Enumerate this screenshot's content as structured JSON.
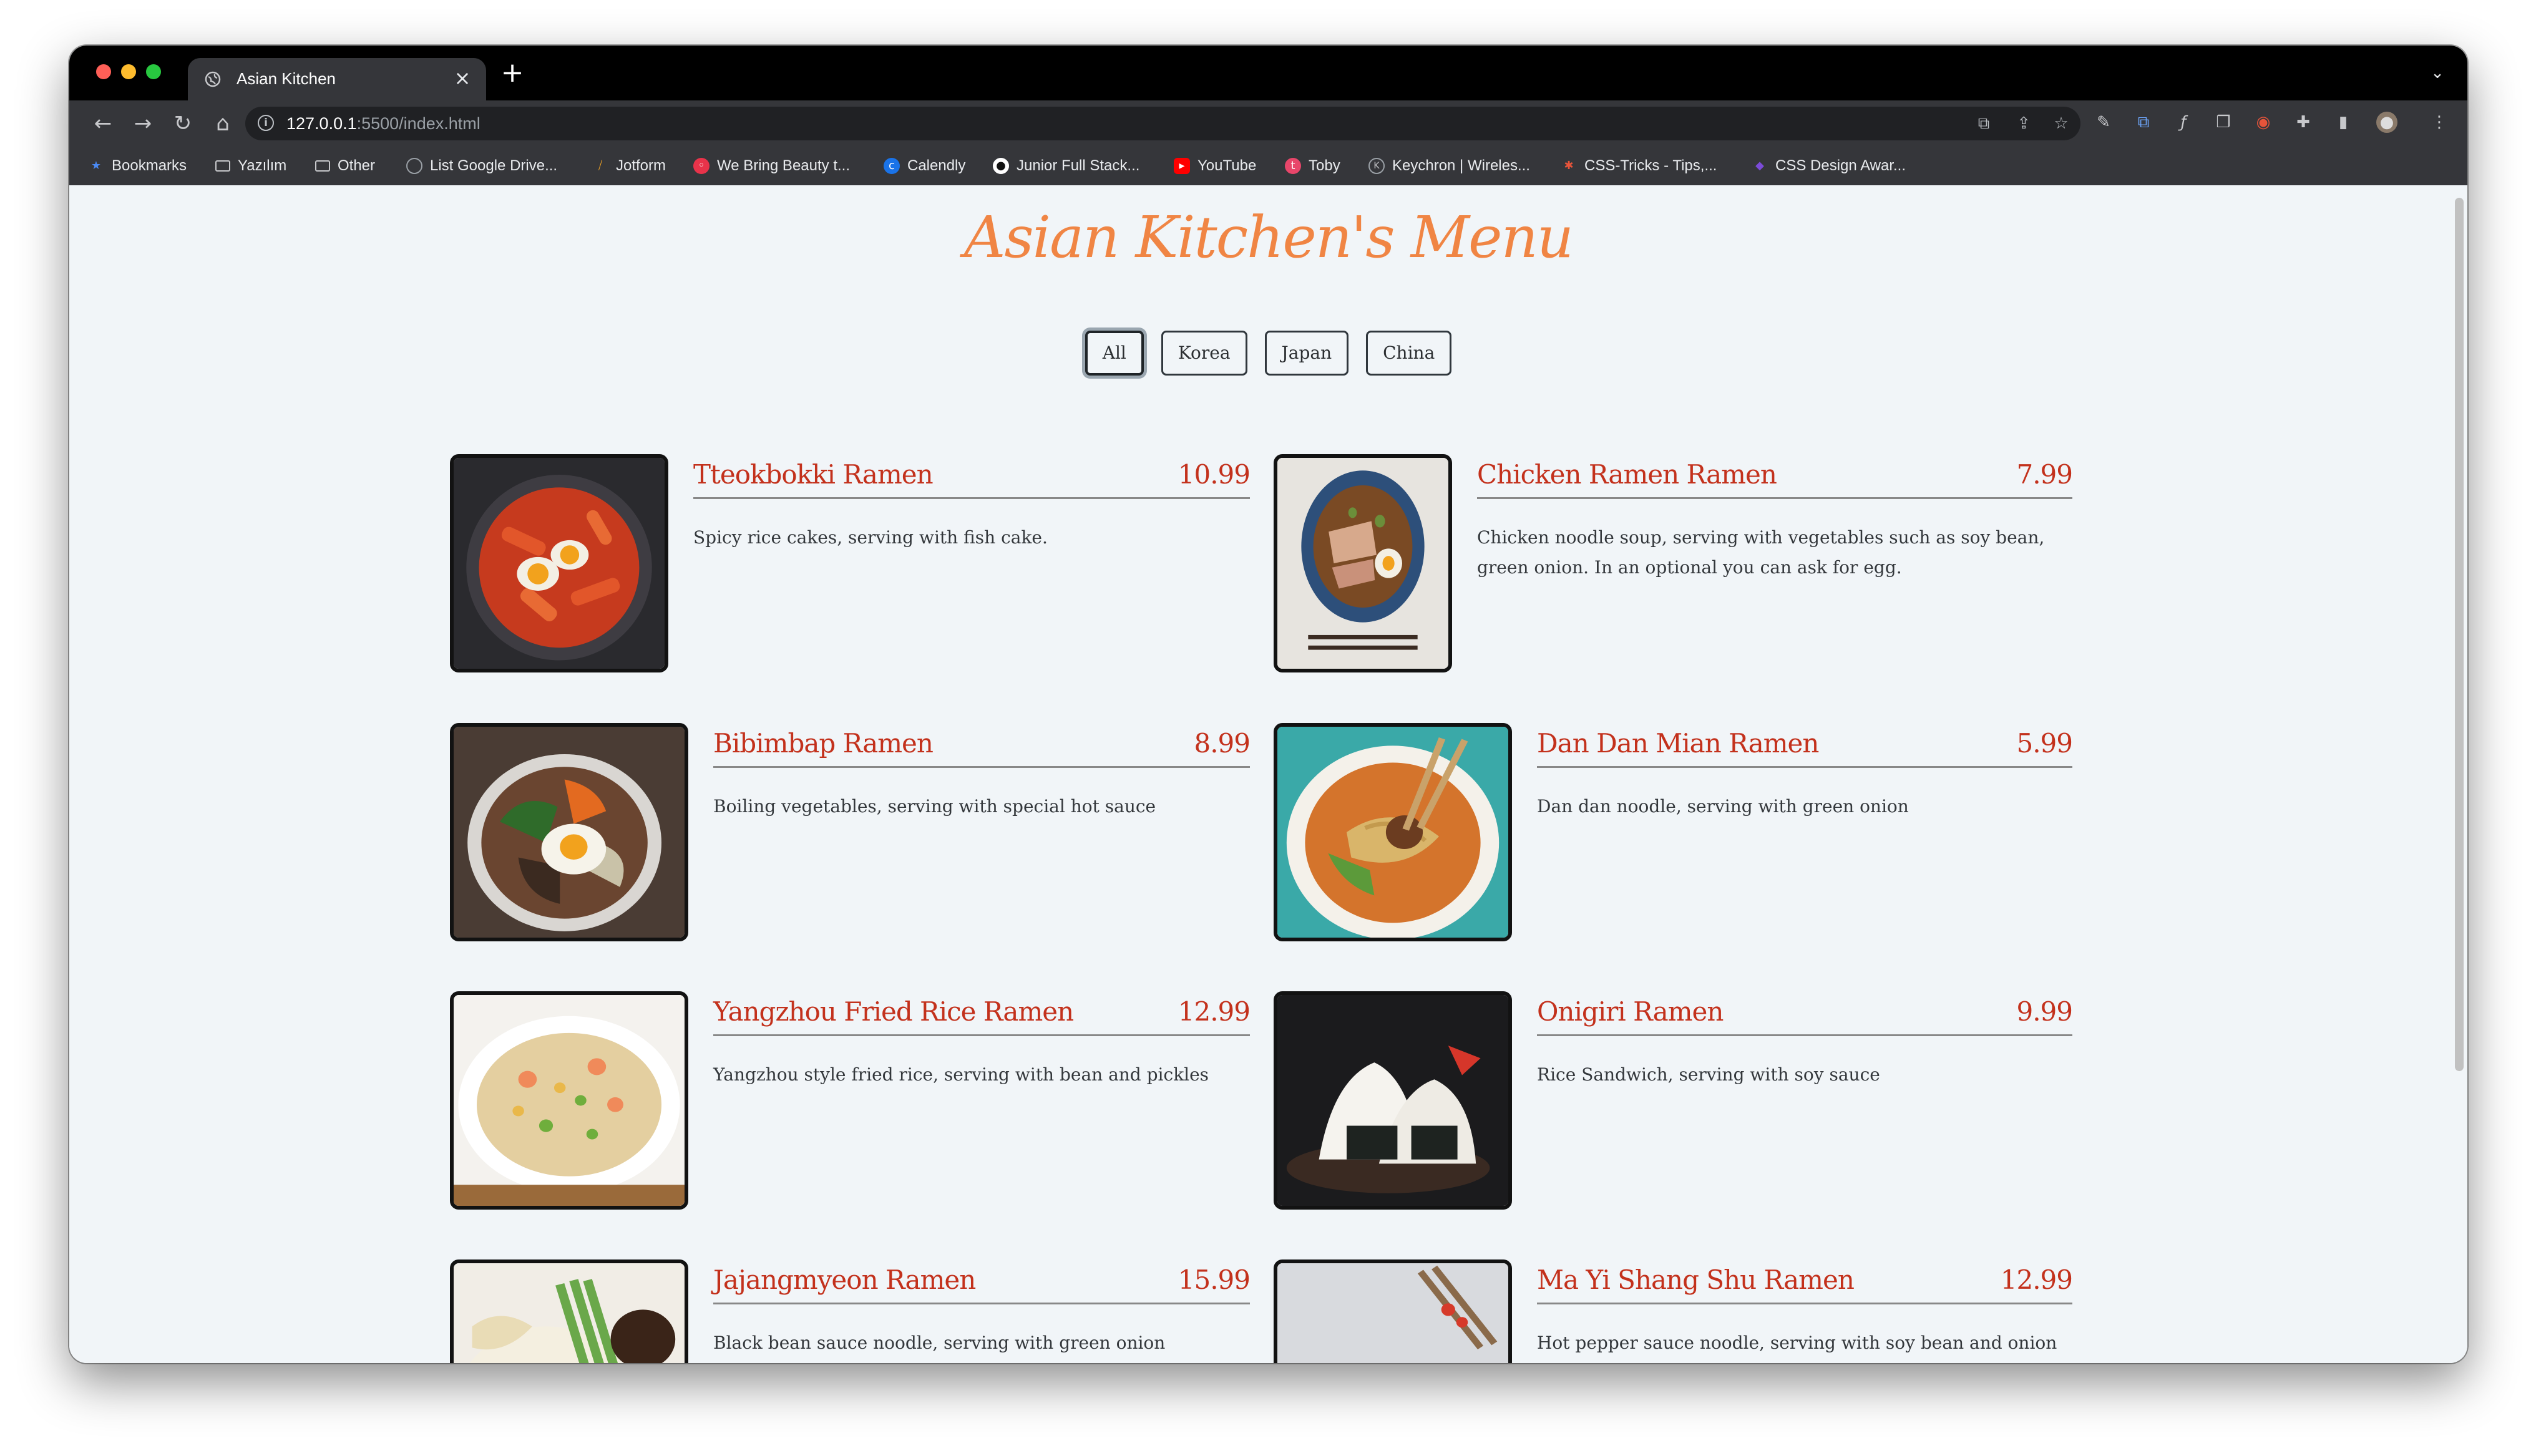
{
  "browser": {
    "tab_title": "Asian Kitchen",
    "tab_close": "×",
    "new_tab": "+",
    "url_host": "127.0.0.1",
    "url_rest": ":5500/index.html",
    "bookmarks": [
      {
        "label": "Bookmarks",
        "icon": "star-icon",
        "color": "#4a8af4"
      },
      {
        "label": "Yazılım",
        "icon": "folder-icon",
        "color": "#c7c8cb"
      },
      {
        "label": "Other",
        "icon": "folder-icon",
        "color": "#c7c8cb"
      },
      {
        "label": "List Google Drive...",
        "icon": "globe-icon",
        "color": "#9aa0a6"
      },
      {
        "label": "Jotform",
        "icon": "jotform-icon",
        "color": "#f6a623"
      },
      {
        "label": "We Bring Beauty t...",
        "icon": "beauty-icon",
        "color": "#e8334a"
      },
      {
        "label": "Calendly",
        "icon": "calendly-icon",
        "color": "#1a73e8"
      },
      {
        "label": "Junior Full Stack...",
        "icon": "jfs-icon",
        "color": "#111111"
      },
      {
        "label": "YouTube",
        "icon": "youtube-icon",
        "color": "#ff0000"
      },
      {
        "label": "Toby",
        "icon": "toby-icon",
        "color": "#e8466a"
      },
      {
        "label": "Keychron | Wireles...",
        "icon": "keychron-icon",
        "color": "#9aa0a6"
      },
      {
        "label": "CSS-Tricks - Tips,...",
        "icon": "css-tricks-icon",
        "color": "#e8543a"
      },
      {
        "label": "CSS Design Awar...",
        "icon": "cssda-icon",
        "color": "#7b4bd8"
      }
    ]
  },
  "page": {
    "title": "Asian Kitchen's Menu",
    "filters": [
      "All",
      "Korea",
      "Japan",
      "China"
    ],
    "active_filter": "All",
    "items": [
      {
        "name": "Tteokbokki Ramen",
        "price": "10.99",
        "desc": "Spicy rice cakes, serving with fish cake.",
        "image": "tteokbokki-photo"
      },
      {
        "name": "Chicken Ramen Ramen",
        "price": "7.99",
        "desc": "Chicken noodle soup, serving with vegetables such as soy bean, green onion. In an optional you can ask for egg.",
        "image": "chicken-ramen-photo"
      },
      {
        "name": "Bibimbap Ramen",
        "price": "8.99",
        "desc": "Boiling vegetables, serving with special hot sauce",
        "image": "bibimbap-photo"
      },
      {
        "name": "Dan Dan Mian Ramen",
        "price": "5.99",
        "desc": "Dan dan noodle, serving with green onion",
        "image": "dandan-photo"
      },
      {
        "name": "Yangzhou Fried Rice Ramen",
        "price": "12.99",
        "desc": "Yangzhou style fried rice, serving with bean and pickles",
        "image": "fried-rice-photo"
      },
      {
        "name": "Onigiri Ramen",
        "price": "9.99",
        "desc": "Rice Sandwich, serving with soy sauce",
        "image": "onigiri-photo"
      },
      {
        "name": "Jajangmyeon Ramen",
        "price": "15.99",
        "desc": "Black bean sauce noodle, serving with green onion",
        "image": "jajangmyeon-photo"
      },
      {
        "name": "Ma Yi Shang Shu Ramen",
        "price": "12.99",
        "desc": "Hot pepper sauce noodle, serving with soy bean and onion",
        "image": "mayi-photo"
      }
    ]
  },
  "colors": {
    "accent_title": "#f08544",
    "item_text": "#c3311c"
  }
}
